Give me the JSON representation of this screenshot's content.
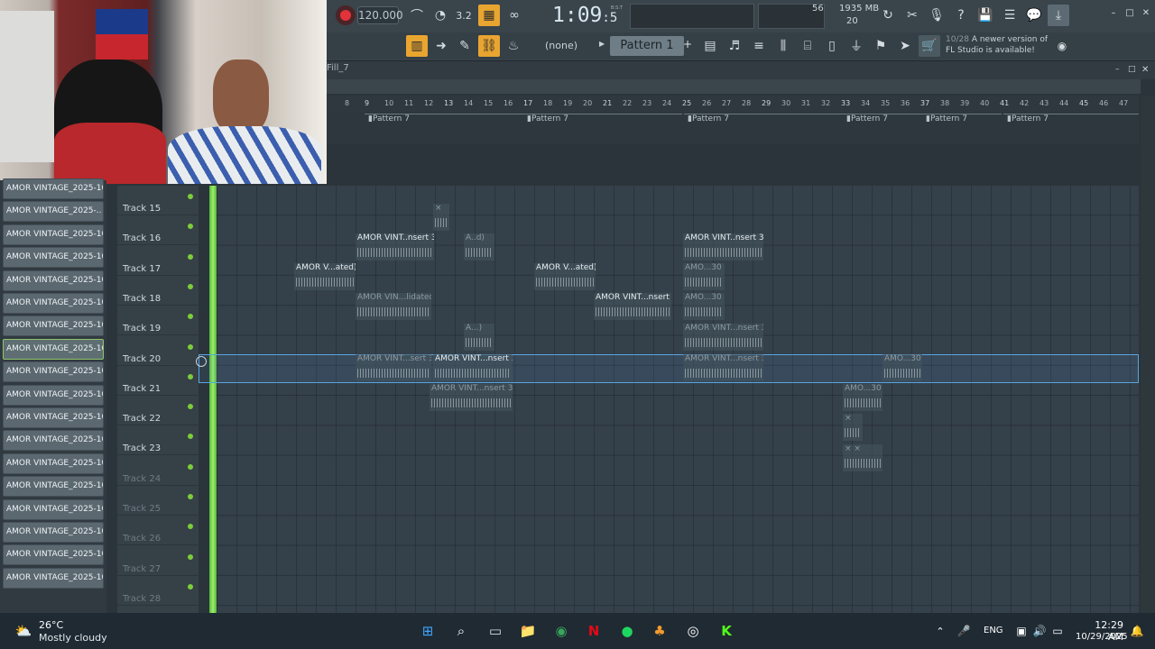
{
  "toolbar": {
    "bpm": "120.000",
    "time": "1:09",
    "time_small": ":5",
    "time_unit": "B:S:T",
    "cpu": "56",
    "ram": "1935 MB",
    "polyphony": "20",
    "pattern_none": "(none)",
    "pattern": "Pattern 1",
    "pattern_plus": "+",
    "update_count": "10/28",
    "update_text": "A newer version of FL Studio is available!"
  },
  "playlist": {
    "title": "Fill_7",
    "ruler": [
      "8",
      "9",
      "10",
      "11",
      "12",
      "13",
      "14",
      "15",
      "16",
      "17",
      "18",
      "19",
      "20",
      "21",
      "22",
      "23",
      "24",
      "25",
      "26",
      "27",
      "28",
      "29",
      "30",
      "31",
      "32",
      "33",
      "34",
      "35",
      "36",
      "37",
      "38",
      "39",
      "40",
      "41",
      "42",
      "43",
      "44",
      "45",
      "46",
      "47"
    ],
    "pattern_label": "Pattern 7",
    "tracks": [
      "Track 15",
      "Track 16",
      "Track 17",
      "Track 18",
      "Track 19",
      "Track 20",
      "Track 21",
      "Track 22",
      "Track 23",
      "Track 24",
      "Track 25",
      "Track 26",
      "Track 27",
      "Track 28"
    ]
  },
  "samples": [
    "AMOR VINTAGE_2025-10-..",
    "AMOR VINTAGE_2025-..",
    "AMOR VINTAGE_2025-10-..",
    "AMOR VINTAGE_2025-10-..",
    "AMOR VINTAGE_2025-10-..",
    "AMOR VINTAGE_2025-10-..",
    "AMOR VINTAGE_2025-10-..",
    "AMOR VINTAGE_2025-10-..",
    "AMOR VINTAGE_2025-10-..",
    "AMOR VINTAGE_2025-10-..",
    "AMOR VINTAGE_2025-10-..",
    "AMOR VINTAGE_2025-10-..",
    "AMOR VINTAGE_2025-10-..",
    "AMOR VINTAGE_2025-10-..",
    "AMOR VINTAGE_2025-10-..",
    "AMOR VINTAGE_2025-10-..",
    "AMOR VINTAGE_2025-10-..",
    "AMOR VINTAGE_2025-10-.."
  ],
  "clips": {
    "c16a": "AMOR VINT..nsert 30",
    "c16b": "A..d)",
    "c16c": "AMOR VINT..nsert 30",
    "c17a": "AMOR V...ated)",
    "c17b": "AMOR V...ated)",
    "c17c": "AMO...30",
    "c18a": "AMOR VIN...lidated)",
    "c18b": "AMOR VINT...nsert 30",
    "c18c": "AMO...30",
    "c19a": "A...)",
    "c19b": "AMOR VINT...nsert 30",
    "c20a": "AMOR VINT...sert 30",
    "c20b": "AMOR VINT...nsert 30",
    "c20c": "AMOR VINT...nsert 30",
    "c20d": "AMO...30",
    "c21a": "AMOR VINT...nsert 30",
    "c21b": "AMO...30"
  },
  "taskbar": {
    "temp": "26°C",
    "weather": "Mostly cloudy",
    "lang": "ENG",
    "time": "12:29 AM",
    "date": "10/29/2025"
  },
  "colors": {
    "accent": "#e8a530",
    "playhead": "#7ccd3a",
    "selection": "#5aa4e0"
  }
}
